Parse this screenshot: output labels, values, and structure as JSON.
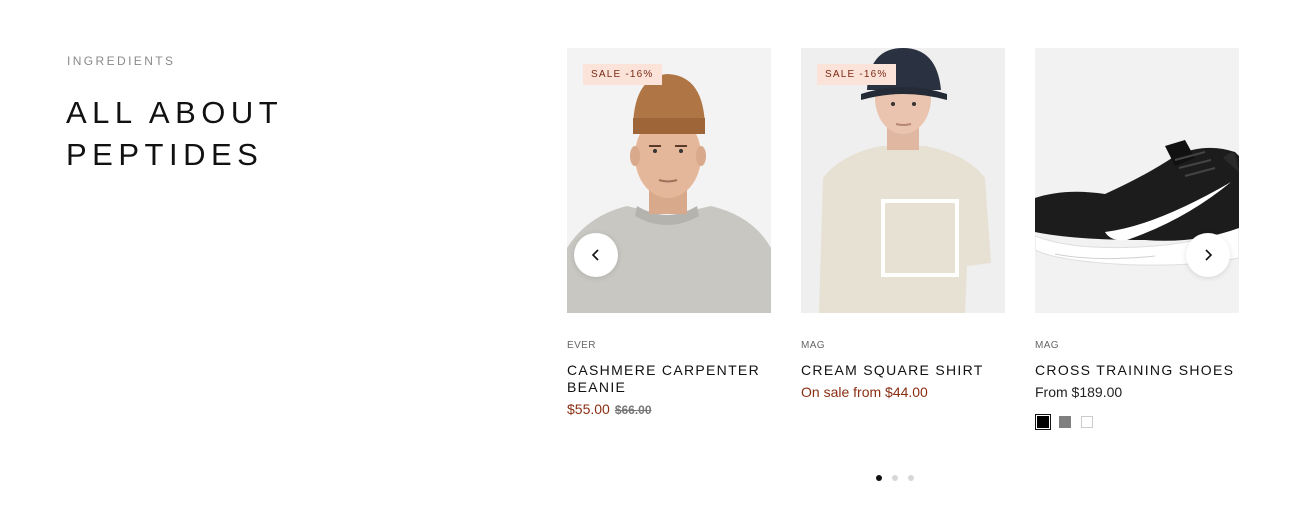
{
  "section": {
    "eyebrow": "INGREDIENTS",
    "headline_line1": "ALL ABOUT",
    "headline_line2": "PEPTIDES"
  },
  "products": [
    {
      "vendor": "EVER",
      "title": "CASHMERE CARPENTER BEANIE",
      "badge": "SALE -16%",
      "price": "$55.00",
      "compare_price": "$66.00",
      "image": "beanie-model-photo"
    },
    {
      "vendor": "MAG",
      "title": "CREAM SQUARE SHIRT",
      "badge": "SALE -16%",
      "price": "On sale from $44.00",
      "image": "shirt-model-photo"
    },
    {
      "vendor": "MAG",
      "title": "CROSS TRAINING SHOES",
      "price": "From $189.00",
      "image": "sneaker-photo",
      "swatches": [
        {
          "color": "#000000",
          "selected": true
        },
        {
          "color": "#808080",
          "selected": false
        },
        {
          "color": "#ffffff",
          "selected": false
        }
      ]
    }
  ],
  "carousel": {
    "prev_icon": "chevron-left-icon",
    "next_icon": "chevron-right-icon",
    "pages": 3,
    "active_page": 1
  },
  "colors": {
    "sale_badge_bg": "#fbe3da",
    "sale_text": "#8a2e12"
  }
}
